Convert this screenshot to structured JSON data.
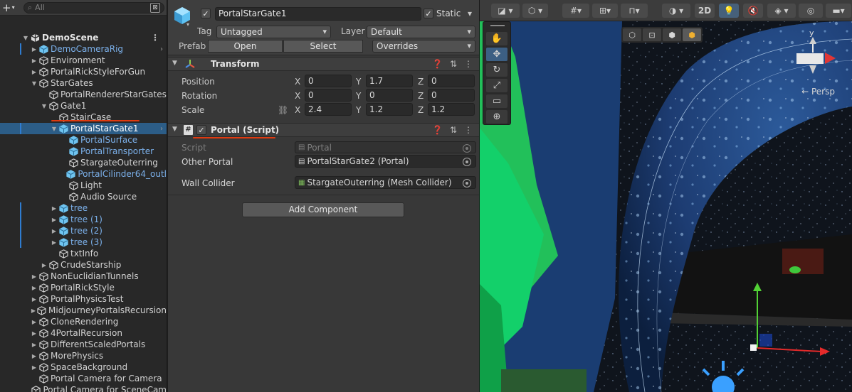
{
  "hierarchy": {
    "search_placeholder": "All",
    "scene_name": "DemoScene",
    "items": [
      {
        "label": "DemoCameraRig",
        "depth": 1,
        "arrow": "right",
        "prefab": true,
        "mark": true,
        "chev": true
      },
      {
        "label": "Environment",
        "depth": 1,
        "arrow": "right"
      },
      {
        "label": "PortalRickStyleForGun",
        "depth": 1,
        "arrow": "right"
      },
      {
        "label": "StarGates",
        "depth": 1,
        "arrow": "down"
      },
      {
        "label": "PortalRendererStarGates",
        "depth": 2,
        "arrow": "none"
      },
      {
        "label": "Gate1",
        "depth": 2,
        "arrow": "down"
      },
      {
        "label": "StairCase",
        "depth": 3,
        "arrow": "none"
      },
      {
        "label": "PortalStarGate1",
        "depth": 3,
        "arrow": "down",
        "selected": true,
        "mark": true,
        "chev": true,
        "prefab": true
      },
      {
        "label": "PortalSurface",
        "depth": 4,
        "arrow": "none",
        "prefab": true
      },
      {
        "label": "PortalTransporter",
        "depth": 4,
        "arrow": "none",
        "prefab": true
      },
      {
        "label": "StargateOuterring",
        "depth": 4,
        "arrow": "none"
      },
      {
        "label": "PortalCilinder64_outl",
        "depth": 4,
        "arrow": "none",
        "prefab": true
      },
      {
        "label": "Light",
        "depth": 4,
        "arrow": "none"
      },
      {
        "label": "Audio Source",
        "depth": 4,
        "arrow": "none"
      },
      {
        "label": "tree",
        "depth": 3,
        "arrow": "right",
        "prefab": true,
        "mark": true
      },
      {
        "label": "tree (1)",
        "depth": 3,
        "arrow": "right",
        "prefab": true,
        "mark": true
      },
      {
        "label": "tree (2)",
        "depth": 3,
        "arrow": "right",
        "prefab": true,
        "mark": true
      },
      {
        "label": "tree (3)",
        "depth": 3,
        "arrow": "right",
        "prefab": true,
        "mark": true
      },
      {
        "label": "txtInfo",
        "depth": 3,
        "arrow": "none"
      },
      {
        "label": "CrudeStarship",
        "depth": 2,
        "arrow": "right"
      },
      {
        "label": "NonEuclidianTunnels",
        "depth": 1,
        "arrow": "right"
      },
      {
        "label": "PortalRickStyle",
        "depth": 1,
        "arrow": "right"
      },
      {
        "label": "PortalPhysicsTest",
        "depth": 1,
        "arrow": "right"
      },
      {
        "label": "MidjourneyPortalsRecursion",
        "depth": 1,
        "arrow": "right"
      },
      {
        "label": "CloneRendering",
        "depth": 1,
        "arrow": "right"
      },
      {
        "label": "4PortalRecursion",
        "depth": 1,
        "arrow": "right"
      },
      {
        "label": "DifferentScaledPortals",
        "depth": 1,
        "arrow": "right"
      },
      {
        "label": "MorePhysics",
        "depth": 1,
        "arrow": "right"
      },
      {
        "label": "SpaceBackground",
        "depth": 1,
        "arrow": "right"
      },
      {
        "label": "Portal Camera for Camera",
        "depth": 1,
        "arrow": "none"
      },
      {
        "label": "Portal Camera for SceneCam",
        "depth": 1,
        "arrow": "none"
      }
    ]
  },
  "inspector": {
    "object_name": "PortalStarGate1",
    "static_label": "Static",
    "tag_label": "Tag",
    "tag_value": "Untagged",
    "layer_label": "Layer",
    "layer_value": "Default",
    "prefab_label": "Prefab",
    "open_label": "Open",
    "select_label": "Select",
    "overrides_label": "Overrides",
    "transform": {
      "title": "Transform",
      "position_label": "Position",
      "rotation_label": "Rotation",
      "scale_label": "Scale",
      "x": "X",
      "y": "Y",
      "z": "Z",
      "position": [
        "0",
        "1.7",
        "0"
      ],
      "rotation": [
        "0",
        "0",
        "0"
      ],
      "scale": [
        "2.4",
        "1.2",
        "1.2"
      ]
    },
    "portal_script": {
      "title": "Portal (Script)",
      "script_label": "Script",
      "script_value": "Portal",
      "other_portal_label": "Other Portal",
      "other_portal_value": "PortalStarGate2 (Portal)",
      "wall_collider_label": "Wall Collider",
      "wall_collider_value": "StargateOuterring (Mesh Collider)"
    },
    "add_component_label": "Add Component"
  },
  "scene": {
    "toolbar": {
      "mode_2d": "2D"
    },
    "persp_label": "← Persp",
    "gizmo_y": "y"
  },
  "colors": {
    "selection": "#2c5d87",
    "prefab_text": "#7bb0ea",
    "annotation_red": "#e03a10"
  }
}
